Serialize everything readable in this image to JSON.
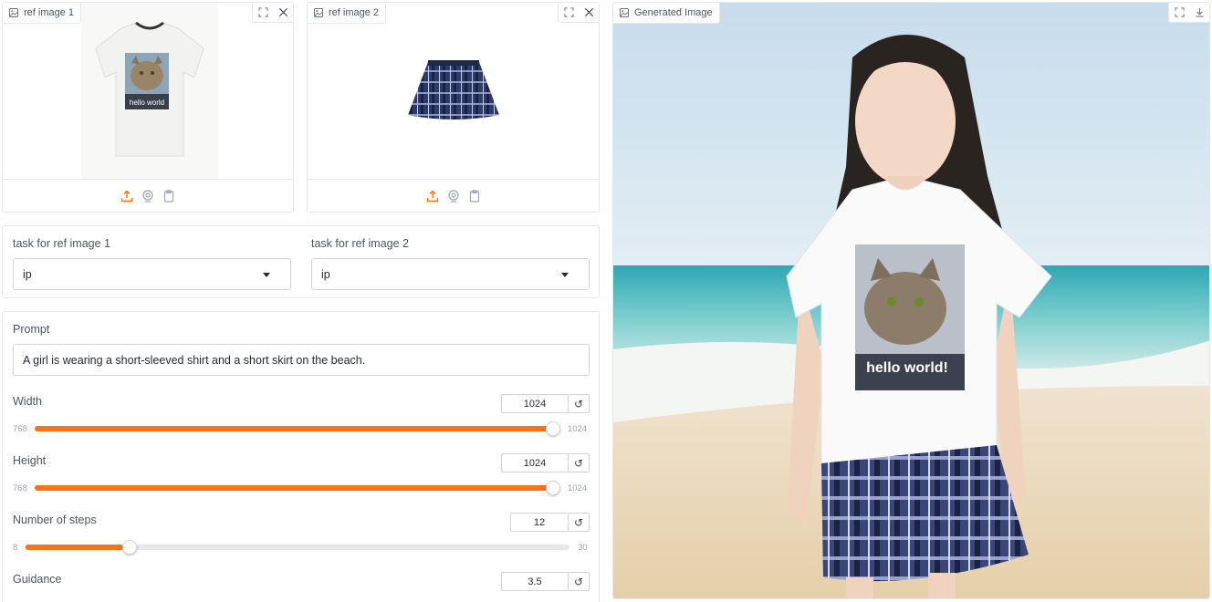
{
  "ref_image_1": {
    "label": "ref image 1",
    "content": "white t-shirt with cat photo print",
    "print_text": "hello world"
  },
  "ref_image_2": {
    "label": "ref image 2",
    "content": "navy blue plaid pleated skirt"
  },
  "generated": {
    "label": "Generated Image",
    "content": "girl in white cat-print t-shirt and plaid skirt on a beach",
    "print_text": "hello world!"
  },
  "tasks": {
    "task1": {
      "label": "task for ref image 1",
      "value": "ip"
    },
    "task2": {
      "label": "task for ref image 2",
      "value": "ip"
    }
  },
  "prompt": {
    "label": "Prompt",
    "value": "A girl is wearing a short-sleeved shirt and a short skirt on the beach."
  },
  "width": {
    "label": "Width",
    "value": "1024",
    "min": "768",
    "max": "1024",
    "fraction": 1.0
  },
  "height": {
    "label": "Height",
    "value": "1024",
    "min": "768",
    "max": "1024",
    "fraction": 1.0
  },
  "steps": {
    "label": "Number of steps",
    "value": "12",
    "min": "8",
    "max": "30",
    "fraction": 0.18
  },
  "guidance": {
    "label": "Guidance",
    "value": "3.5"
  },
  "colors": {
    "accent": "#f97316"
  },
  "icons": [
    "image-icon",
    "fullscreen-icon",
    "close-icon",
    "upload-icon",
    "webcam-icon",
    "clipboard-icon",
    "download-icon",
    "reset-icon"
  ]
}
